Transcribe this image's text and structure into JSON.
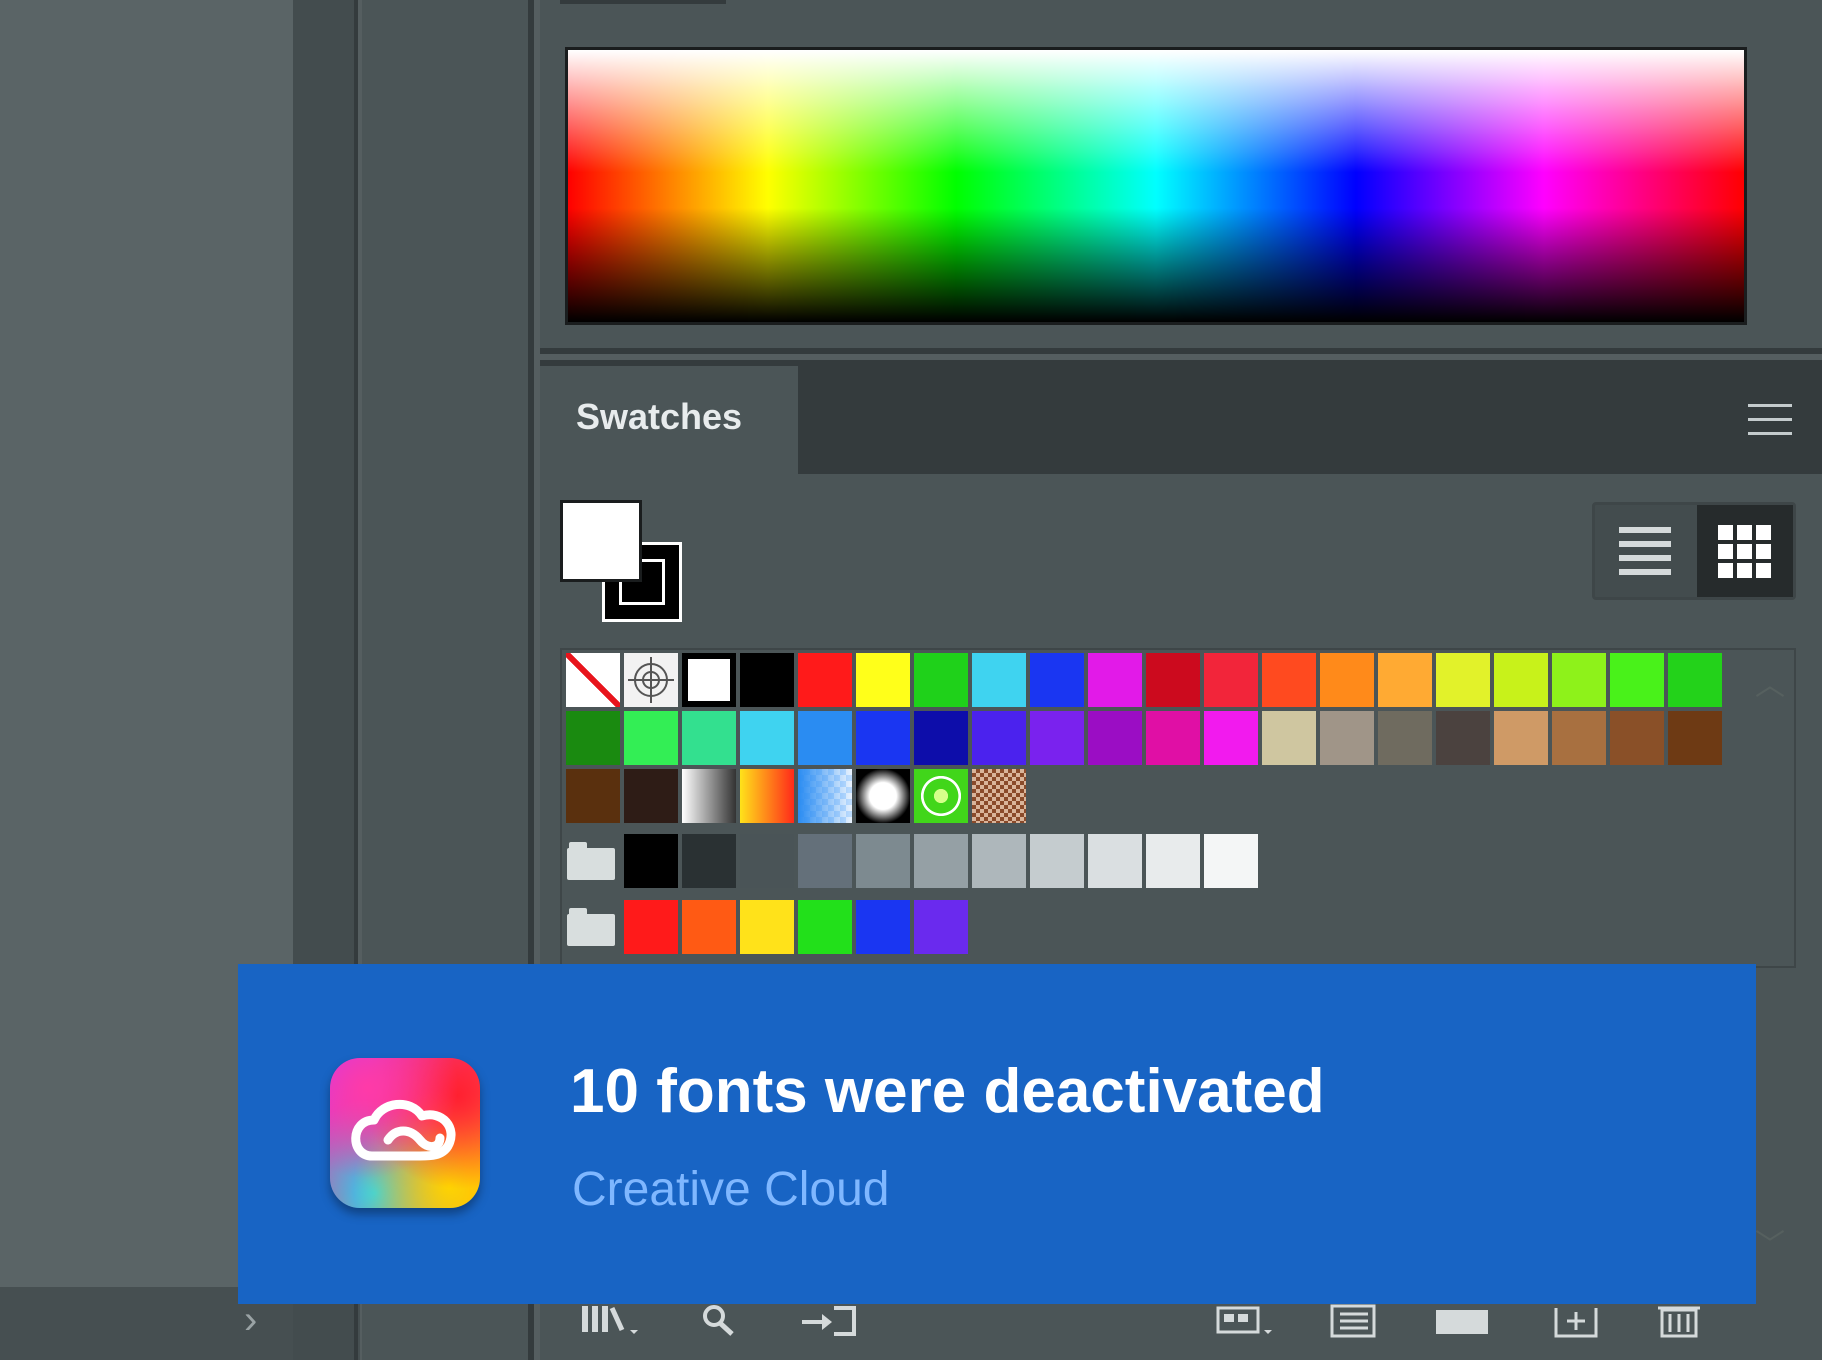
{
  "swatches_panel": {
    "tab_label": "Swatches",
    "menu_icon": "hamburger-menu-icon"
  },
  "color_panel": {
    "spectrum": "color-spectrum"
  },
  "view_toggle": {
    "list_icon": "list-view-icon",
    "grid_icon": "grid-view-icon",
    "selected": "grid"
  },
  "fill_color": "#ffffff",
  "stroke_color": "#000000",
  "swatch_rows": [
    [
      "none",
      "registration",
      "white",
      "#000000",
      "#ff1a1a",
      "#ffff1a",
      "#1fd11a",
      "#3fd3f0",
      "#1a36f2",
      "#e21ae8",
      "#cc0a1e",
      "#f2253a",
      "#ff4a1f",
      "#ff8a1a",
      "#ffaa33",
      "#e2f22a",
      "#c8f21a",
      "#8ef21a",
      "#49f21a",
      "#23d21a"
    ],
    [
      "#1a8a10",
      "#33ee55",
      "#33e08f",
      "#3fd3f0",
      "#2a8cf2",
      "#1a36f2",
      "#0d0daa",
      "#4b22ee",
      "#7a22ee",
      "#9b0dc4",
      "#e00fa5",
      "#f21aee",
      "#cfc6a0",
      "#a09588",
      "#6f6b5f",
      "#4b423f",
      "#cf9a66",
      "#a87040",
      "#8a5028",
      "#6e3a14"
    ],
    [
      "#5a300e",
      "#2e1c16",
      "pattern-gray-gradient",
      "pattern-orange-gradient",
      "pattern-blue-checker",
      "pattern-radial-white",
      "pattern-green-floral",
      "pattern-brown-texture"
    ]
  ],
  "gray_group": [
    "#000000",
    "#2a3133",
    "#4a5457",
    "#64707a",
    "#7d8a90",
    "#95a0a5",
    "#aeb7bb",
    "#c5cccf",
    "#dadfe1",
    "#e8ebec",
    "#f4f6f6"
  ],
  "color_group": [
    "#ff1a1a",
    "#ff5a14",
    "#ffe21a",
    "#22e01a",
    "#1a36f2",
    "#6a2aee"
  ],
  "bottom_toolbar": {
    "icons": [
      "libraries-icon",
      "find-swatch-icon",
      "place-swatches-icon",
      "swatch-kind-menu-icon",
      "swatch-options-icon",
      "new-color-group-icon",
      "new-swatch-icon",
      "delete-swatch-icon"
    ]
  },
  "notification": {
    "title": "10 fonts were deactivated",
    "source": "Creative Cloud",
    "icon": "creative-cloud-logo-icon",
    "background": "#1864c4"
  },
  "left_panel": {
    "collapse_glyph": "›"
  }
}
